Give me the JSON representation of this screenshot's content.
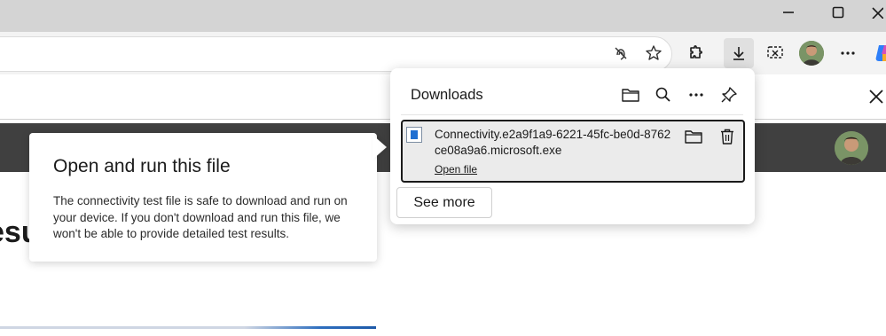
{
  "window": {
    "minimize_icon": "minimize-icon",
    "maximize_icon": "maximize-icon",
    "close_icon": "close-icon"
  },
  "toolbar": {
    "icons": [
      "tracking-prevention-icon",
      "favorite-star-icon",
      "extensions-icon",
      "downloads-icon",
      "screenshot-icon",
      "profile-avatar",
      "more-icon",
      "copilot-icon"
    ]
  },
  "page": {
    "partial_heading": "esu"
  },
  "callout": {
    "title": "Open and run this file",
    "body": "The connectivity test file is safe to download and run on your device. If you don't download and run this file, we won't be able to provide detailed test results."
  },
  "downloads": {
    "title": "Downloads",
    "item": {
      "filename": "Connectivity.e2a9f1a9-6221-45fc-be0d-8762ce08a9a6.microsoft.exe",
      "open_label": "Open file"
    },
    "see_more_label": "See more"
  },
  "colors": {
    "accent": "#1f6fd1",
    "dark_band": "#404040",
    "titlebar": "#d4d4d4"
  }
}
